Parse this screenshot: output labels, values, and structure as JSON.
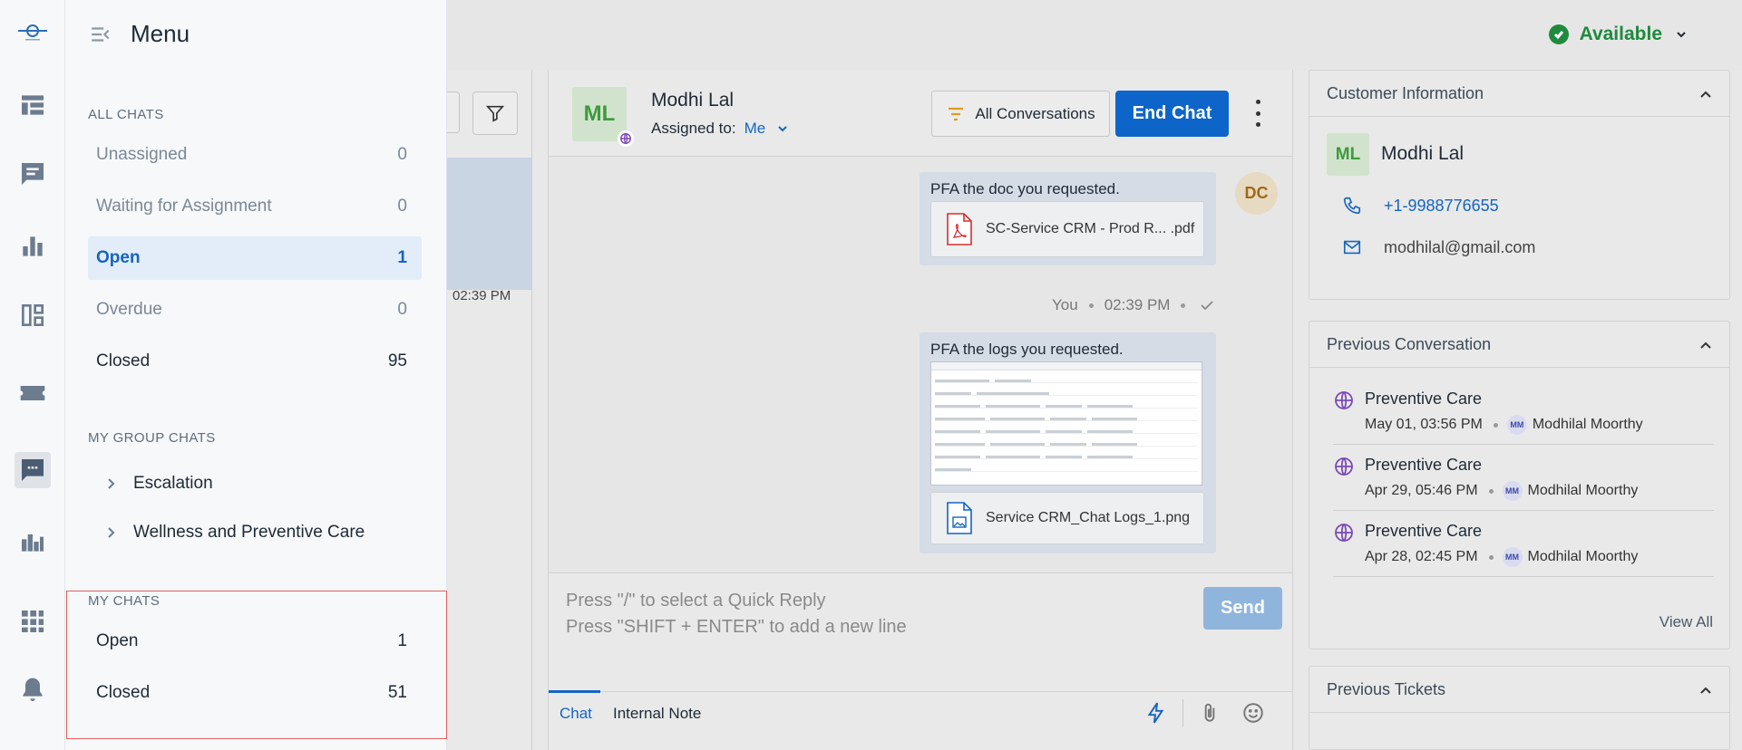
{
  "menu": {
    "title": "Menu",
    "sections": {
      "all_chats": "ALL CHATS",
      "my_group_chats": "MY GROUP CHATS",
      "my_chats": "MY CHATS"
    },
    "all_chats": [
      {
        "label": "Unassigned",
        "count": "0"
      },
      {
        "label": "Waiting for Assignment",
        "count": "0"
      },
      {
        "label": "Open",
        "count": "1"
      },
      {
        "label": "Overdue",
        "count": "0"
      },
      {
        "label": "Closed",
        "count": "95"
      }
    ],
    "groups": [
      {
        "label": "Escalation"
      },
      {
        "label": "Wellness and Preventive Care"
      }
    ],
    "my_chats": [
      {
        "label": "Open",
        "count": "1"
      },
      {
        "label": "Closed",
        "count": "51"
      }
    ]
  },
  "topbar": {
    "status": "Available",
    "status_color": "#1f8a3e"
  },
  "chat_list": {
    "selected_time": "02:39 PM"
  },
  "conversation": {
    "contact_initials": "ML",
    "contact_name": "Modhi Lal",
    "assigned_label": "Assigned to:",
    "assigned_value": "Me",
    "all_conversations": "All Conversations",
    "end_chat": "End Chat",
    "accent_color": "#0d65c9",
    "messages": [
      {
        "text": "PFA the doc you requested.",
        "file": "SC-Service CRM - Prod R... .pdf",
        "sender_initials": "DC"
      },
      {
        "text": "PFA the logs you requested.",
        "file": "Service CRM_Chat Logs_1.png"
      }
    ],
    "meta": {
      "sender": "You",
      "time": "02:39 PM"
    },
    "composer": {
      "placeholder_1": "Press \"/\" to select a Quick Reply",
      "placeholder_2": "Press \"SHIFT + ENTER\" to add a new line",
      "send": "Send",
      "tab_chat": "Chat",
      "tab_note": "Internal Note"
    }
  },
  "customer_info": {
    "title": "Customer Information",
    "initials": "ML",
    "name": "Modhi Lal",
    "phone": "+1-9988776655",
    "email": "modhilal@gmail.com"
  },
  "previous_conversation": {
    "title": "Previous Conversation",
    "items": [
      {
        "title": "Preventive Care",
        "date": "May 01, 03:56 PM",
        "agent_initials": "MM",
        "agent": "Modhilal Moorthy"
      },
      {
        "title": "Preventive Care",
        "date": "Apr 29, 05:46 PM",
        "agent_initials": "MM",
        "agent": "Modhilal Moorthy"
      },
      {
        "title": "Preventive Care",
        "date": "Apr 28, 02:45 PM",
        "agent_initials": "MM",
        "agent": "Modhilal Moorthy"
      }
    ],
    "view_all": "View All"
  },
  "previous_tickets": {
    "title": "Previous Tickets"
  }
}
